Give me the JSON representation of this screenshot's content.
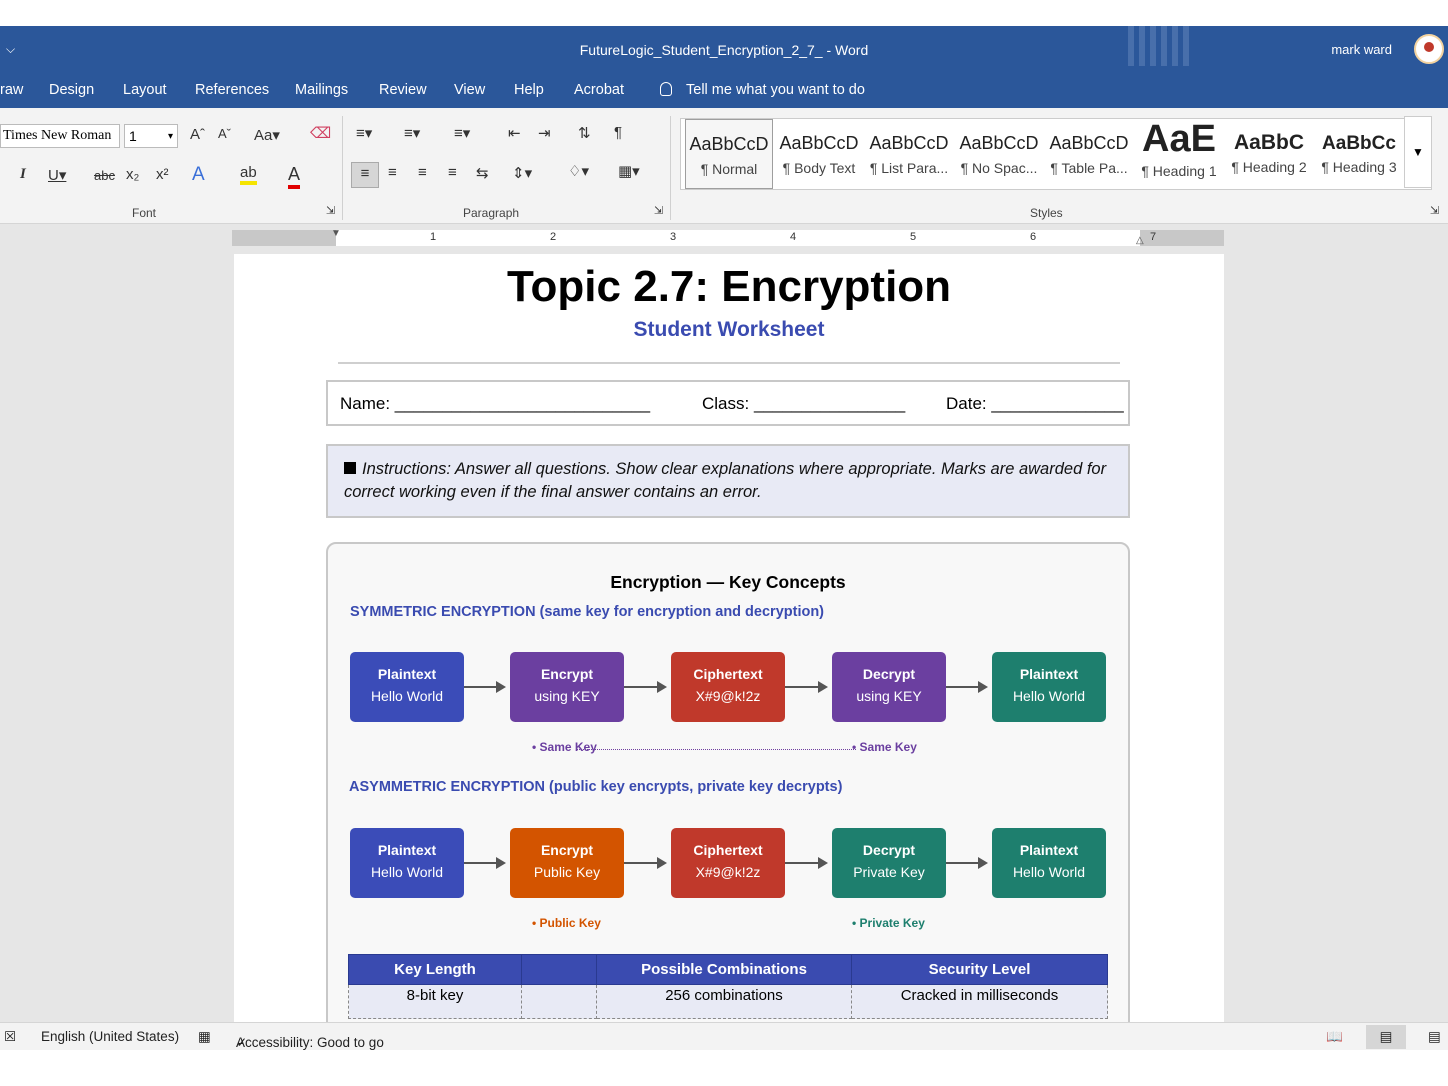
{
  "window": {
    "quick_access": "⌵",
    "title": "FutureLogic_Student_Encryption_2_7_  -  Word",
    "user": "mark ward"
  },
  "tabs": [
    "raw",
    "Design",
    "Layout",
    "References",
    "Mailings",
    "Review",
    "View",
    "Help",
    "Acrobat"
  ],
  "tell_me": "Tell me what you want to do",
  "ribbon": {
    "font_name": "Times New Roman",
    "font_size": "1",
    "groups": {
      "font": "Font",
      "paragraph": "Paragraph",
      "styles": "Styles"
    },
    "styles": [
      {
        "sample": "AaBbCcD",
        "label": "¶ Normal"
      },
      {
        "sample": "AaBbCcD",
        "label": "¶ Body Text"
      },
      {
        "sample": "AaBbCcD",
        "label": "¶ List Para..."
      },
      {
        "sample": "AaBbCcD",
        "label": "¶ No Spac..."
      },
      {
        "sample": "AaBbCcD",
        "label": "¶ Table Pa..."
      },
      {
        "sample": "AaE",
        "label": "¶ Heading 1"
      },
      {
        "sample": "AaBbC",
        "label": "¶ Heading 2"
      },
      {
        "sample": "AaBbCc",
        "label": "¶ Heading 3"
      }
    ]
  },
  "ruler": [
    "1",
    "2",
    "3",
    "4",
    "5",
    "6",
    "7"
  ],
  "doc": {
    "title": "Topic 2.7: Encryption",
    "subtitle": "Student Worksheet",
    "name_label": "Name: ___________________________",
    "class_label": "Class: ________________",
    "date_label": "Date: ______________",
    "instructions": "Instructions: Answer all questions. Show clear explanations where appropriate. Marks are awarded for correct working even if the final answer contains an error.",
    "diagram_title": "Encryption — Key Concepts",
    "symmetric_heading": "SYMMETRIC ENCRYPTION  (same key for encryption and decryption)",
    "asymmetric_heading": "ASYMMETRIC ENCRYPTION  (public key encrypts, private key decrypts)",
    "symmetric_boxes": [
      {
        "l1": "Plaintext",
        "l2": "Hello World",
        "color": "#3b4cb8"
      },
      {
        "l1": "Encrypt",
        "l2": "using KEY",
        "color": "#6b3fa0"
      },
      {
        "l1": "Ciphertext",
        "l2": "X#9@k!2z",
        "color": "#c0392b"
      },
      {
        "l1": "Decrypt",
        "l2": "using KEY",
        "color": "#6b3fa0"
      },
      {
        "l1": "Plaintext",
        "l2": "Hello World",
        "color": "#1e7f6e"
      }
    ],
    "asymmetric_boxes": [
      {
        "l1": "Plaintext",
        "l2": "Hello World",
        "color": "#3b4cb8"
      },
      {
        "l1": "Encrypt",
        "l2": "Public Key",
        "color": "#d35400"
      },
      {
        "l1": "Ciphertext",
        "l2": "X#9@k!2z",
        "color": "#c0392b"
      },
      {
        "l1": "Decrypt",
        "l2": "Private Key",
        "color": "#1e7f6e"
      },
      {
        "l1": "Plaintext",
        "l2": "Hello World",
        "color": "#1e7f6e"
      }
    ],
    "sym_key_left": "•  Same Key",
    "sym_key_right": "•  Same Key",
    "asym_key_left": "•  Public Key",
    "asym_key_right": "•  Private Key",
    "colors": {
      "sym_key": "#6b3fa0",
      "public_key": "#d35400",
      "private_key": "#1e7f6e"
    },
    "table": {
      "headers": [
        "Key Length",
        "",
        "Possible Combinations",
        "Security Level"
      ],
      "rows": [
        [
          "8-bit key",
          "",
          "256 combinations",
          "Cracked in milliseconds"
        ]
      ]
    }
  },
  "status": {
    "language": "English (United States)",
    "accessibility": "Accessibility: Good to go"
  }
}
